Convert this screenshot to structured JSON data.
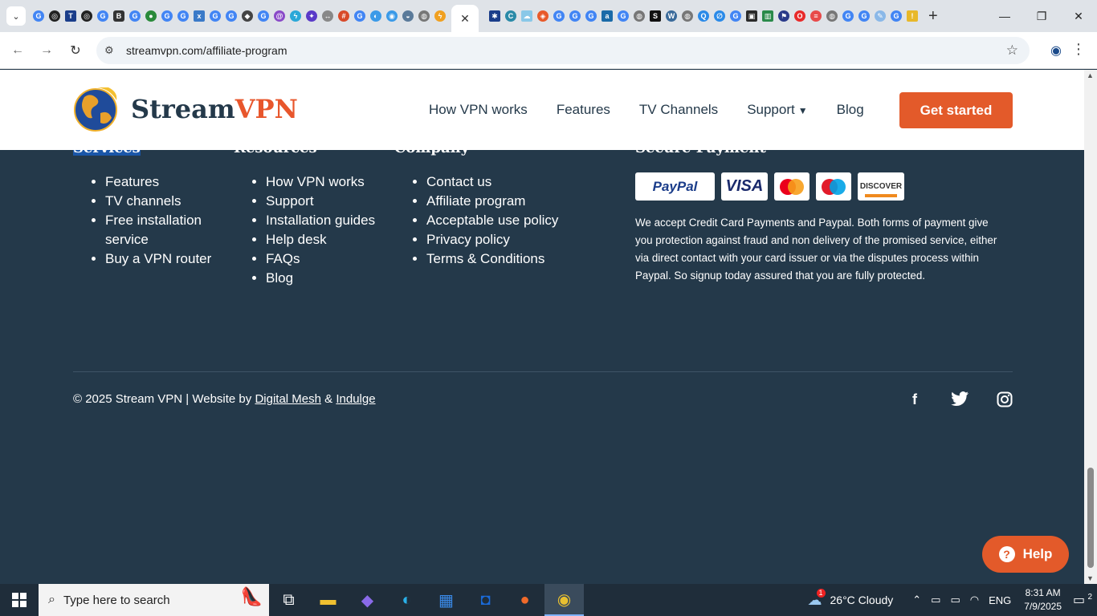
{
  "browser": {
    "url": "streamvpn.com/affiliate-program",
    "close_tab": "✕",
    "new_tab": "+"
  },
  "site": {
    "logo_part1": "Stream",
    "logo_part2": "VPN",
    "nav": [
      {
        "label": "How VPN works"
      },
      {
        "label": "Features"
      },
      {
        "label": "TV Channels"
      },
      {
        "label": "Support"
      },
      {
        "label": "Blog"
      }
    ],
    "cta": "Get started"
  },
  "footer": {
    "headings": {
      "services": "Services",
      "resources": "Resources",
      "company": "Company",
      "payment": "Secure Payment"
    },
    "services": [
      "Features",
      "TV channels",
      "Free installation service",
      "Buy a VPN router"
    ],
    "resources": [
      "How VPN works",
      "Support",
      "Installation guides",
      "Help desk",
      "FAQs",
      "Blog"
    ],
    "company": [
      "Contact us",
      "Affiliate program",
      "Acceptable use policy",
      "Privacy policy",
      "Terms & Conditions"
    ],
    "payment_methods": [
      "PayPal",
      "VISA",
      "DISCOVER"
    ],
    "payment_text": "We accept Credit Card Payments and Paypal. Both forms of payment give you protection against fraud and non delivery of the promised service, either via direct contact with your card issuer or via the disputes process within Paypal. So signup today assured that you are fully protected.",
    "copyright_prefix": "© 2025 Stream VPN | Website by",
    "credit1": "Digital Mesh",
    "amp": "&",
    "credit2": "Indulge",
    "social": [
      "facebook-icon",
      "twitter-icon",
      "instagram-icon"
    ]
  },
  "help_button": "Help",
  "taskbar": {
    "search_placeholder": "Type here to search",
    "weather_badge": "1",
    "weather": "26°C  Cloudy",
    "language": "ENG",
    "time": "8:31 AM",
    "date": "7/9/2025",
    "notifications": "2"
  },
  "colors": {
    "accent": "#e35a2a",
    "footer_bg": "#24394a",
    "brand_dark": "#24394a"
  }
}
